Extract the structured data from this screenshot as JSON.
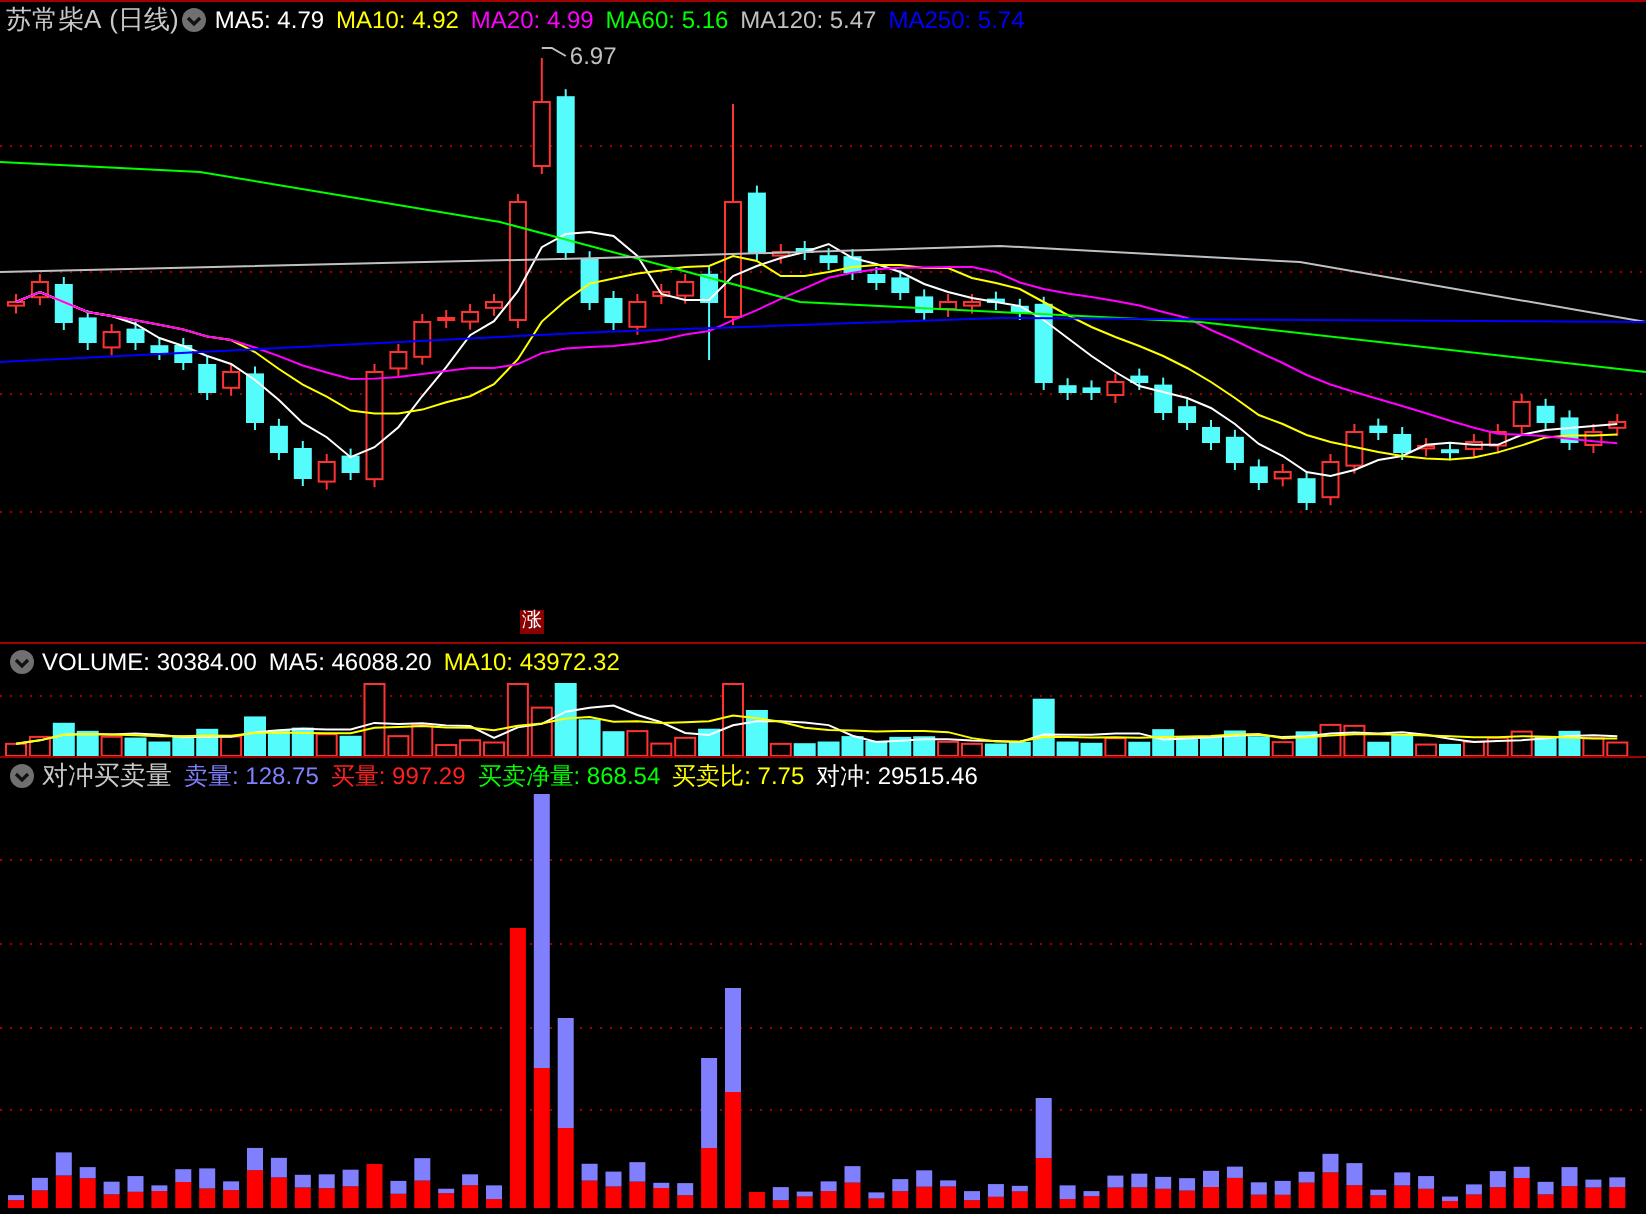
{
  "chart_title": {
    "name": "苏常柴A",
    "period": "(日线)"
  },
  "price_legend": [
    {
      "text": "MA5: 4.79",
      "color": "#ffffff"
    },
    {
      "text": "MA10: 4.92",
      "color": "#ffff00"
    },
    {
      "text": "MA20: 4.99",
      "color": "#ff00ff"
    },
    {
      "text": "MA60: 5.16",
      "color": "#00ff00"
    },
    {
      "text": "MA120: 5.47",
      "color": "#c0c0c0"
    },
    {
      "text": "MA250: 5.74",
      "color": "#0000ff"
    }
  ],
  "high_label": "6.97",
  "rise_marker": "涨",
  "volume_legend": [
    {
      "text": "VOLUME: 30384.00",
      "color": "#ffffff"
    },
    {
      "text": "MA5: 46088.20",
      "color": "#ffffff"
    },
    {
      "text": "MA10: 43972.32",
      "color": "#ffff00"
    }
  ],
  "indicator_title": "对冲买卖量",
  "indicator_legend": [
    {
      "text": "卖量: 128.75",
      "color": "#8080ff"
    },
    {
      "text": "买量: 997.29",
      "color": "#ff2020"
    },
    {
      "text": "买卖净量: 868.54",
      "color": "#00ff00"
    },
    {
      "text": "买卖比: 7.75",
      "color": "#ffff00"
    },
    {
      "text": "对冲: 29515.46",
      "color": "#ffffff"
    }
  ]
}
